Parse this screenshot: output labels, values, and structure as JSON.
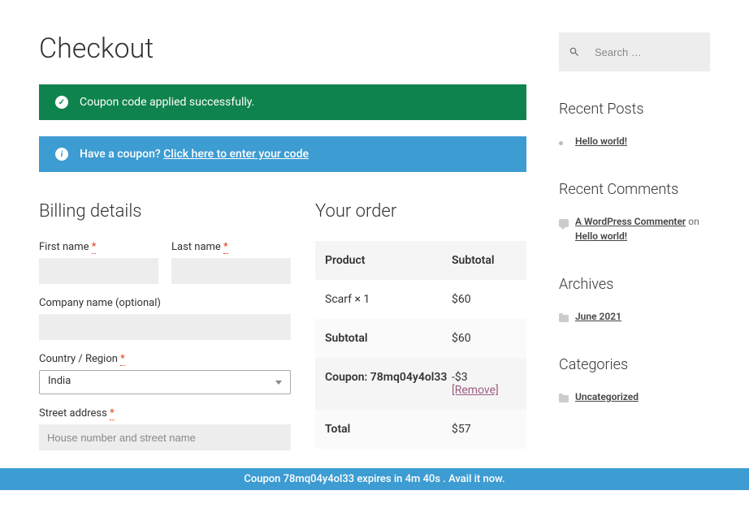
{
  "page_title": "Checkout",
  "success_msg": "Coupon code applied successfully.",
  "coupon_prompt": "Have a coupon? ",
  "coupon_link": "Click here to enter your code",
  "billing": {
    "heading": "Billing details",
    "first_name_label": "First name ",
    "last_name_label": "Last name ",
    "company_label": "Company name (optional)",
    "country_label": "Country / Region ",
    "country_value": "India",
    "street_label": "Street address ",
    "street_ph": "House number and street name",
    "required": "*"
  },
  "order": {
    "heading": "Your order",
    "th_product": "Product",
    "th_subtotal": "Subtotal",
    "item_name": "Scarf  × 1",
    "item_price": "$60",
    "subtotal_label": "Subtotal",
    "subtotal_value": "$60",
    "coupon_label": "Coupon: 78mq04y4ol33",
    "coupon_value": "-$3 ",
    "coupon_remove": "[Remove]",
    "total_label": "Total",
    "total_value": "$57"
  },
  "search_ph": "Search …",
  "widgets": {
    "posts_heading": "Recent Posts",
    "post1": "Hello world!",
    "comments_heading": "Recent Comments",
    "commenter": "A WordPress Commenter",
    "on": " on ",
    "comment_post": "Hello world!",
    "archives_heading": "Archives",
    "archive1": "June 2021",
    "cats_heading": "Categories",
    "cat1": "Uncategorized"
  },
  "footer_banner": "Coupon 78mq04y4ol33 expires in 4m 40s . Avail it now."
}
